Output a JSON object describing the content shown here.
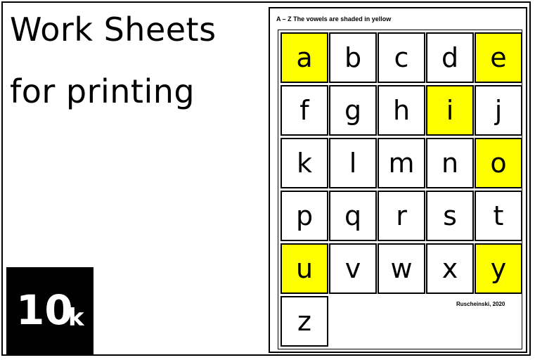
{
  "heading": {
    "line1": "Work Sheets",
    "line2": "for printing"
  },
  "badge": {
    "number": "10",
    "unit": "k"
  },
  "worksheet": {
    "title": "A – Z The vowels are shaded in yellow",
    "credit": "Ruscheinski, 2020",
    "vowel_color": "#ffff00",
    "letters": [
      {
        "char": "a",
        "vowel": true
      },
      {
        "char": "b",
        "vowel": false
      },
      {
        "char": "c",
        "vowel": false
      },
      {
        "char": "d",
        "vowel": false
      },
      {
        "char": "e",
        "vowel": true
      },
      {
        "char": "f",
        "vowel": false
      },
      {
        "char": "g",
        "vowel": false
      },
      {
        "char": "h",
        "vowel": false
      },
      {
        "char": "i",
        "vowel": true
      },
      {
        "char": "j",
        "vowel": false
      },
      {
        "char": "k",
        "vowel": false
      },
      {
        "char": "l",
        "vowel": false
      },
      {
        "char": "m",
        "vowel": false
      },
      {
        "char": "n",
        "vowel": false
      },
      {
        "char": "o",
        "vowel": true
      },
      {
        "char": "p",
        "vowel": false
      },
      {
        "char": "q",
        "vowel": false
      },
      {
        "char": "r",
        "vowel": false
      },
      {
        "char": "s",
        "vowel": false
      },
      {
        "char": "t",
        "vowel": false
      },
      {
        "char": "u",
        "vowel": true
      },
      {
        "char": "v",
        "vowel": false
      },
      {
        "char": "w",
        "vowel": false
      },
      {
        "char": "x",
        "vowel": false
      },
      {
        "char": "y",
        "vowel": true
      },
      {
        "char": "z",
        "vowel": false
      }
    ]
  }
}
